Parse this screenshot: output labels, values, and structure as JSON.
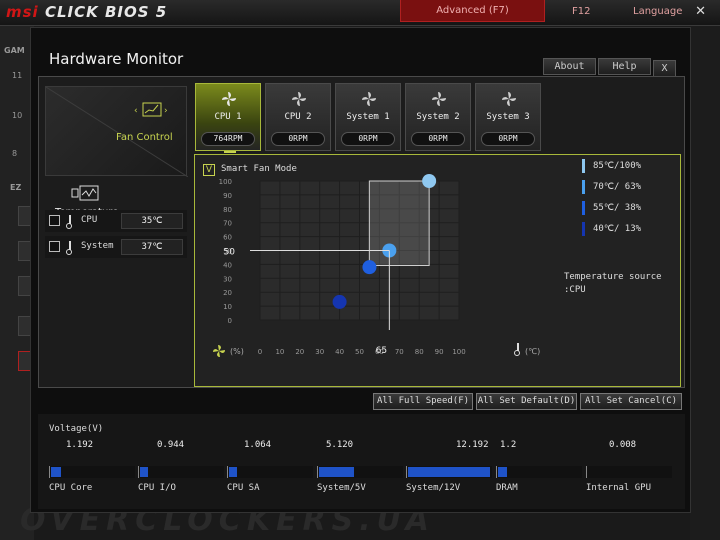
{
  "bios": {
    "logo_brand": "msi",
    "logo_product": "CLICK BIOS 5",
    "mode": "Advanced (F7)",
    "f12": "F12",
    "language": "Language",
    "close": "✕",
    "left_labels": [
      "GAM",
      "11",
      "10",
      "8",
      "EZ"
    ],
    "watermark": "OVERCLOCKERS.UA"
  },
  "dialog": {
    "title": "Hardware Monitor",
    "about": "About",
    "help": "Help",
    "close": "X"
  },
  "side": {
    "fan_control": "Fan Control",
    "temperature": "Temperature",
    "sensors": [
      {
        "name": "CPU",
        "value": "35℃"
      },
      {
        "name": "System",
        "value": "37℃"
      }
    ]
  },
  "fans": [
    {
      "name": "CPU 1",
      "rpm": "764RPM",
      "active": true
    },
    {
      "name": "CPU 2",
      "rpm": "0RPM",
      "active": false
    },
    {
      "name": "System 1",
      "rpm": "0RPM",
      "active": false
    },
    {
      "name": "System 2",
      "rpm": "0RPM",
      "active": false
    },
    {
      "name": "System 3",
      "rpm": "0RPM",
      "active": false
    }
  ],
  "graph": {
    "smart_check": "V",
    "smart_label": "Smart Fan Mode",
    "y_ticks": [
      "100",
      "90",
      "80",
      "70",
      "60",
      "50",
      "40",
      "30",
      "20",
      "10",
      "0"
    ],
    "x_ticks": [
      "0",
      "10",
      "20",
      "30",
      "40",
      "50",
      "60",
      "70",
      "80",
      "90",
      "100"
    ],
    "x_unit": "(℃)",
    "y_unit": "(%)",
    "cursor_temp": "65",
    "cursor_speed": "50",
    "points": [
      {
        "temp": 40,
        "speed": 13
      },
      {
        "temp": 55,
        "speed": 38
      },
      {
        "temp": 65,
        "speed": 50
      },
      {
        "temp": 85,
        "speed": 100
      }
    ],
    "legend": [
      {
        "label": "85℃/100%",
        "color": "#8fc8f0"
      },
      {
        "label": "70℃/ 63%",
        "color": "#4aa0ee"
      },
      {
        "label": "55℃/ 38%",
        "color": "#1f5fe0"
      },
      {
        "label": "40℃/ 13%",
        "color": "#1535b0"
      }
    ],
    "temp_source_label": "Temperature source",
    "temp_source_value": ":CPU"
  },
  "actions": {
    "full_speed": "All Full Speed(F)",
    "set_default": "All Set Default(D)",
    "set_cancel": "All Set Cancel(C)"
  },
  "voltage": {
    "title": "Voltage(V)",
    "items": [
      {
        "name": "CPU Core",
        "value": "1.192",
        "level": 0.12
      },
      {
        "name": "CPU I/O",
        "value": "0.944",
        "level": 0.09
      },
      {
        "name": "CPU SA",
        "value": "1.064",
        "level": 0.1
      },
      {
        "name": "System/5V",
        "value": "5.120",
        "level": 0.42
      },
      {
        "name": "System/12V",
        "value": "12.192",
        "level": 0.98
      },
      {
        "name": "DRAM",
        "value": "1.2",
        "level": 0.11
      },
      {
        "name": "Internal GPU",
        "value": "0.008",
        "level": 0.0
      }
    ]
  }
}
